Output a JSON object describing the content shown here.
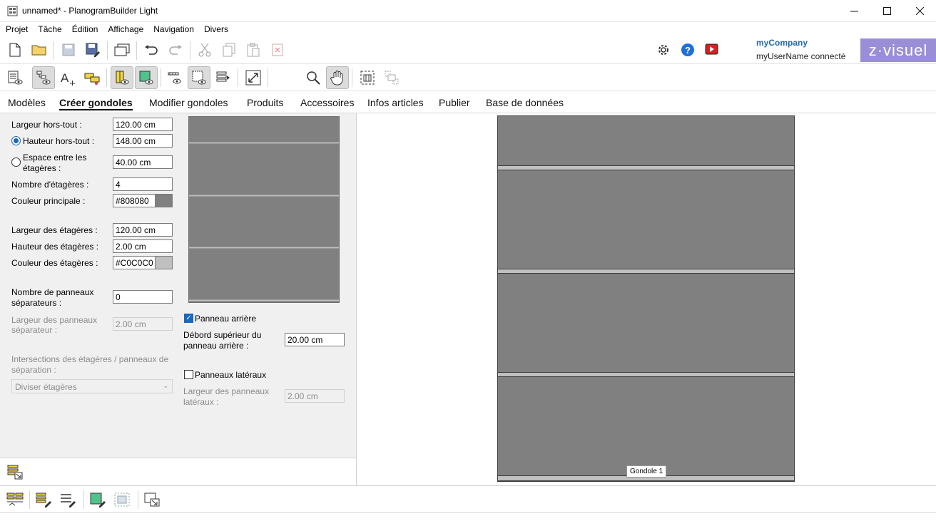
{
  "window": {
    "title": "unnamed* - PlanogramBuilder Light"
  },
  "menu": [
    "Projet",
    "Tâche",
    "Édition",
    "Affichage",
    "Navigation",
    "Divers"
  ],
  "account": {
    "company": "myCompany",
    "user": "myUserName connecté",
    "logo_text": "z·visuel"
  },
  "tabs": [
    {
      "label": "Modèles",
      "active": false
    },
    {
      "label": "Créer gondoles",
      "active": true
    },
    {
      "label": "Modifier gondoles",
      "active": false
    },
    {
      "label": "Produits",
      "active": false
    },
    {
      "label": "Accessoires",
      "active": false
    },
    {
      "label": "Infos articles",
      "active": false
    },
    {
      "label": "Publier",
      "active": false
    },
    {
      "label": "Base de données",
      "active": false
    }
  ],
  "form": {
    "largeur_hors_tout": {
      "label": "Largeur hors-tout :",
      "value": "120.00 cm"
    },
    "hauteur_hors_tout": {
      "label": "Hauteur hors-tout :",
      "value": "148.00 cm",
      "selected": true
    },
    "espace_entre": {
      "label_line1": "Espace entre les",
      "label_line2": "étagères :",
      "value": "40.00 cm",
      "selected": false
    },
    "nombre_etageres": {
      "label": "Nombre d'étagères :",
      "value": "4"
    },
    "couleur_principale": {
      "label": "Couleur principale :",
      "value": "#808080",
      "color": "#808080"
    },
    "largeur_etageres": {
      "label": "Largeur des étagères :",
      "value": "120.00 cm"
    },
    "hauteur_etageres": {
      "label": "Hauteur des étagères :",
      "value": "2.00 cm"
    },
    "couleur_etageres": {
      "label": "Couleur des étagères :",
      "value": "#C0C0C0",
      "color": "#C0C0C0"
    },
    "nombre_panneaux": {
      "label_line1": "Nombre de panneaux",
      "label_line2": "séparateurs :",
      "value": "0"
    },
    "largeur_panneaux": {
      "label_line1": "Largeur des panneaux",
      "label_line2": "séparateur :",
      "value": "2.00 cm",
      "disabled": true
    },
    "intersections": {
      "label_line1": "Intersections des étagères / panneaux de",
      "label_line2": "séparation :",
      "value": "Diviser étagères",
      "disabled": true
    },
    "panneau_arriere": {
      "label": "Panneau arrière",
      "checked": true
    },
    "debord": {
      "label_line1": "Débord supérieur du",
      "label_line2": "panneau arrière :",
      "value": "20.00 cm"
    },
    "panneaux_lateraux": {
      "label": "Panneaux latéraux",
      "checked": false
    },
    "largeur_lateraux": {
      "label_line1": "Largeur des panneaux",
      "label_line2": "latéraux :",
      "value": "2.00 cm",
      "disabled": true
    }
  },
  "canvas": {
    "gondola_label": "Gondole 1"
  },
  "colors": {
    "gondola": "#808080",
    "shelf": "#C0C0C0",
    "accent": "#1867c0",
    "logo_bg": "#9a8ed6"
  }
}
